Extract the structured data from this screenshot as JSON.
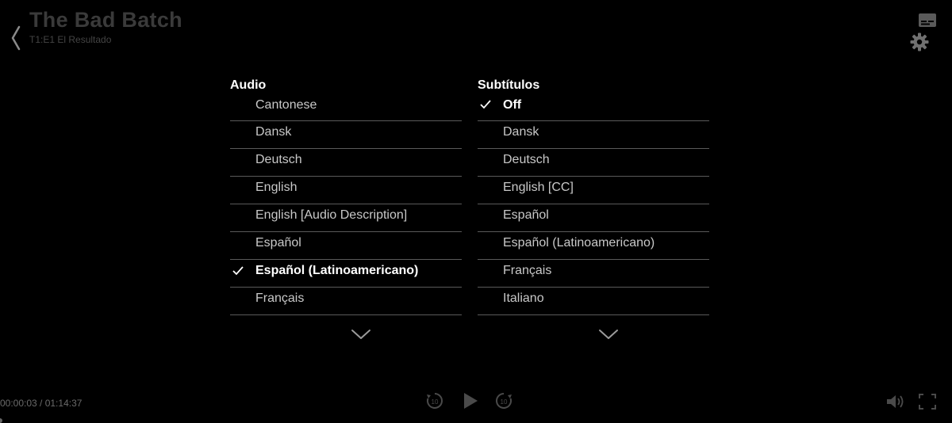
{
  "header": {
    "title": "The Bad Batch",
    "episode": "T1:E1 El Resultado"
  },
  "audio": {
    "heading": "Audio",
    "options": [
      {
        "label": "Cantonese",
        "selected": false
      },
      {
        "label": "Dansk",
        "selected": false
      },
      {
        "label": "Deutsch",
        "selected": false
      },
      {
        "label": "English",
        "selected": false
      },
      {
        "label": "English [Audio Description]",
        "selected": false
      },
      {
        "label": "Español",
        "selected": false
      },
      {
        "label": "Español (Latinoamericano)",
        "selected": true
      },
      {
        "label": "Français",
        "selected": false
      }
    ]
  },
  "subtitles": {
    "heading": "Subtítulos",
    "options": [
      {
        "label": "Off",
        "selected": true
      },
      {
        "label": "Dansk",
        "selected": false
      },
      {
        "label": "Deutsch",
        "selected": false
      },
      {
        "label": "English [CC]",
        "selected": false
      },
      {
        "label": "Español",
        "selected": false
      },
      {
        "label": "Español (Latinoamericano)",
        "selected": false
      },
      {
        "label": "Français",
        "selected": false
      },
      {
        "label": "Italiano",
        "selected": false
      }
    ]
  },
  "player": {
    "timecode": "00:00:03 / 01:14:37",
    "progress_fraction": 0.0007
  },
  "icons": {
    "back": "chevron-left-icon",
    "captions": "captions-icon",
    "settings": "gear-icon",
    "rewind": "rewind-10-icon",
    "play": "play-icon",
    "forward": "forward-10-icon",
    "volume": "volume-icon",
    "fullscreen": "fullscreen-icon",
    "more": "chevron-down-icon",
    "check": "check-icon"
  },
  "colors": {
    "background": "#000000",
    "text_selected": "#ffffff",
    "text_option": "#c8c8c8",
    "divider": "#5a5a5a",
    "dim_controls": "#4a4a4a"
  }
}
